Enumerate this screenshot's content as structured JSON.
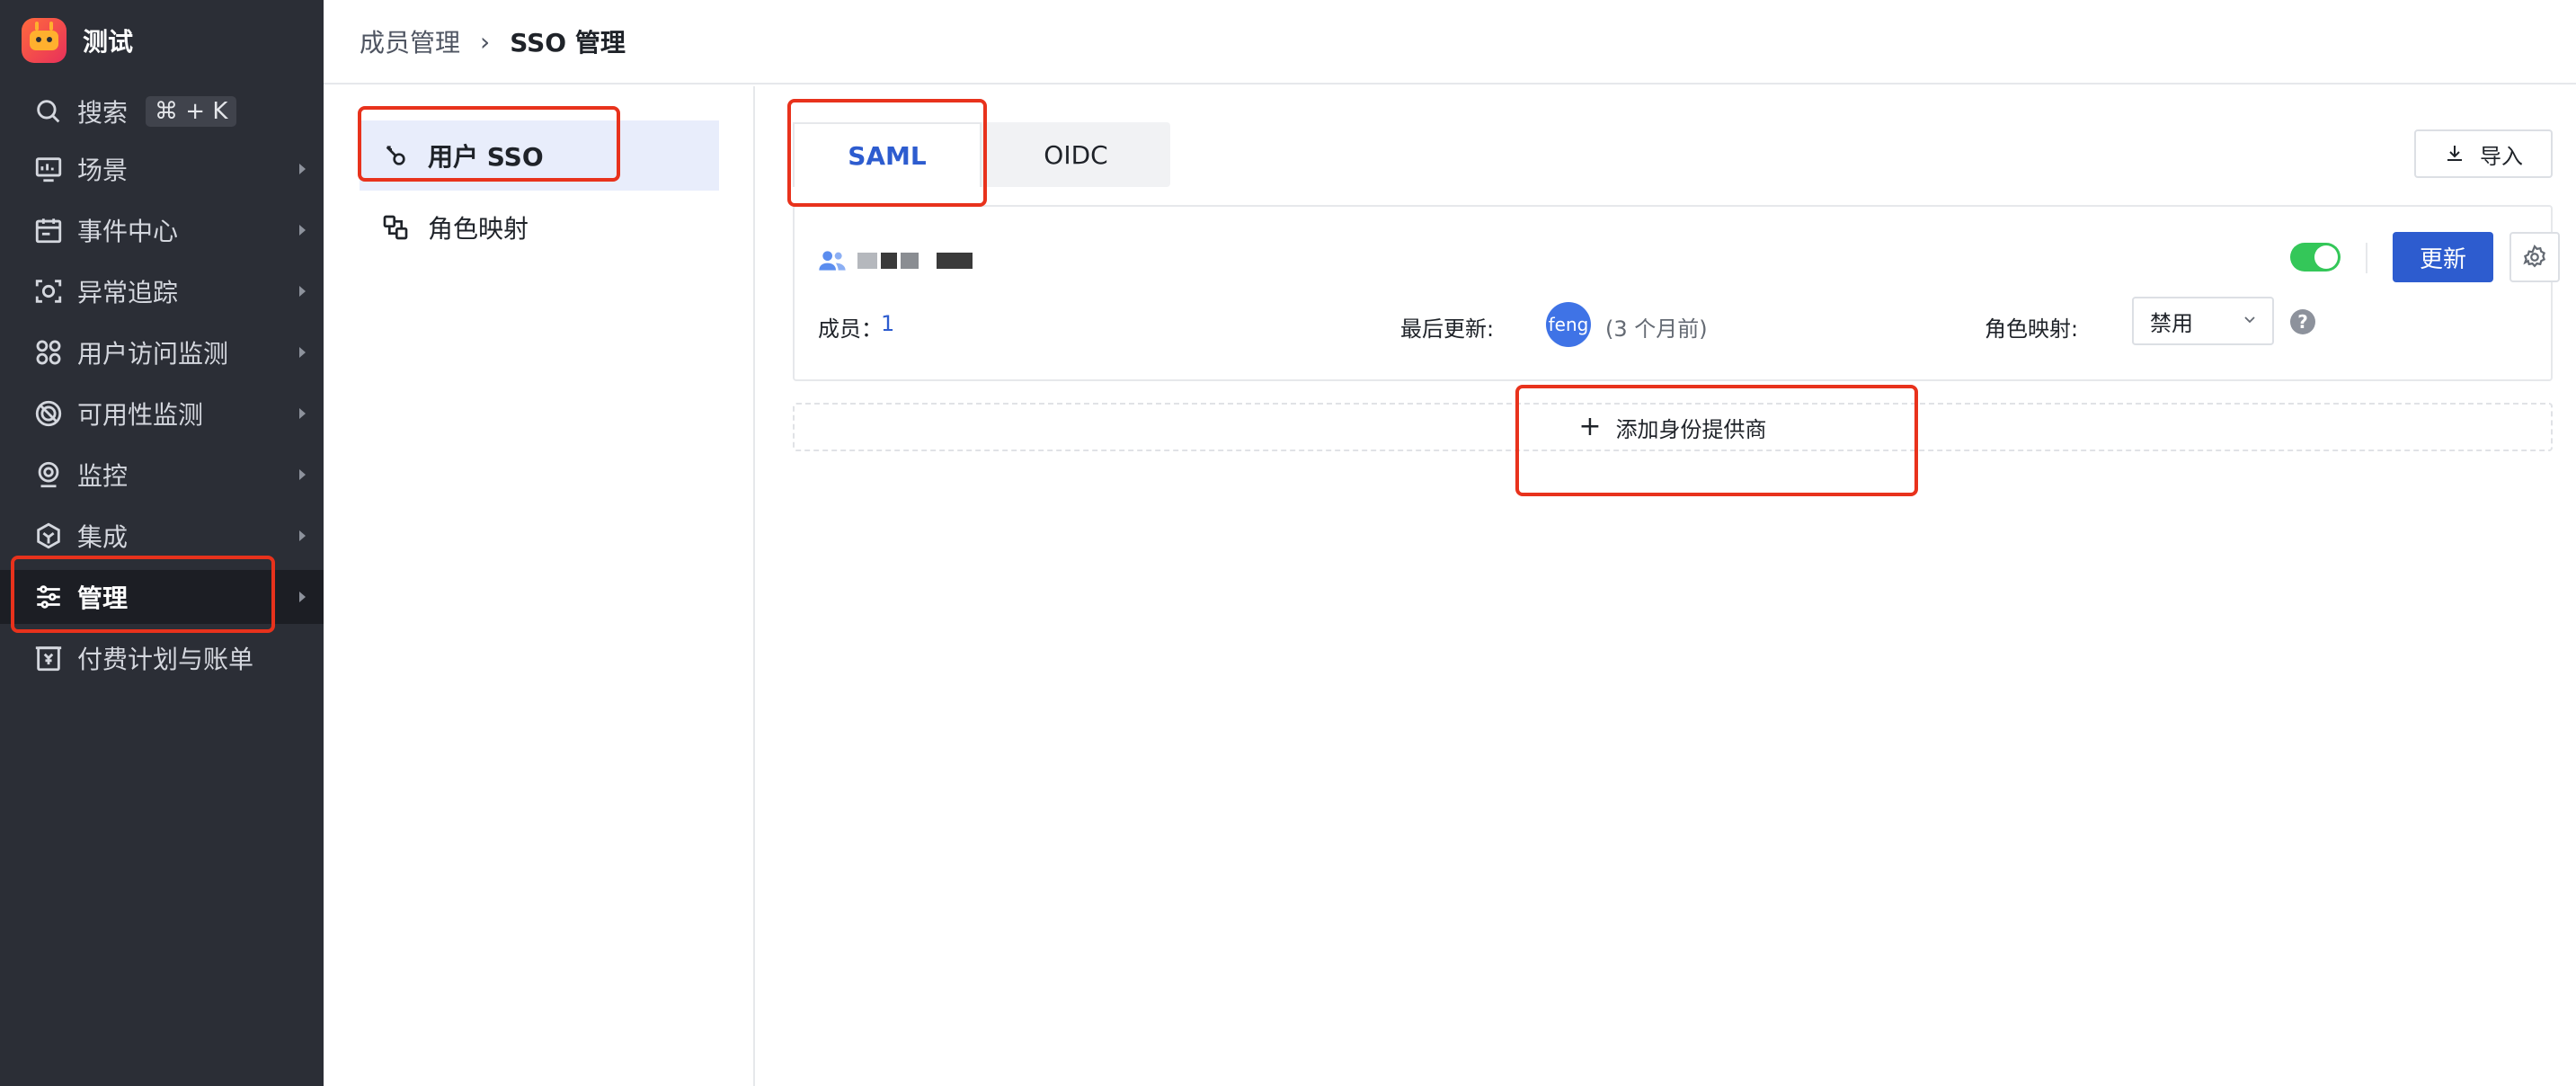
{
  "app": {
    "title": "测试"
  },
  "sidebar": {
    "search": {
      "label": "搜索",
      "shortcut": "⌘ + K"
    },
    "items": [
      {
        "label": "场景",
        "icon": "monitor-icon"
      },
      {
        "label": "事件中心",
        "icon": "calendar-icon"
      },
      {
        "label": "异常追踪",
        "icon": "scan-icon"
      },
      {
        "label": "用户访问监测",
        "icon": "grid-icon"
      },
      {
        "label": "可用性监测",
        "icon": "target-icon"
      },
      {
        "label": "监控",
        "icon": "camera-icon"
      },
      {
        "label": "集成",
        "icon": "cube-icon"
      },
      {
        "label": "管理",
        "icon": "sliders-icon",
        "active": true
      },
      {
        "label": "付费计划与账单",
        "icon": "billing-icon"
      }
    ]
  },
  "header": {
    "breadcrumb_1": "成员管理",
    "separator": "›",
    "breadcrumb_2": "SSO 管理"
  },
  "subnav": {
    "items": [
      {
        "label": "用户 SSO",
        "active": true
      },
      {
        "label": "角色映射"
      }
    ]
  },
  "main": {
    "tabs": [
      {
        "label": "SAML",
        "active": true
      },
      {
        "label": "OIDC"
      }
    ],
    "import_label": "导入",
    "card": {
      "members_label": "成员：",
      "members_count": "1",
      "last_update_label": "最后更新:",
      "avatar_text": "feng",
      "last_update_ago": "(3 个月前)",
      "role_mapping_label": "角色映射:",
      "role_mapping_value": "禁用",
      "toggle_on": true,
      "update_label": "更新"
    },
    "add_provider_label": "添加身份提供商"
  },
  "colors": {
    "accent": "#2d5ccf",
    "sidebar_bg": "#2b2e36",
    "toggle_on": "#34c759",
    "highlight": "#e8321c"
  }
}
